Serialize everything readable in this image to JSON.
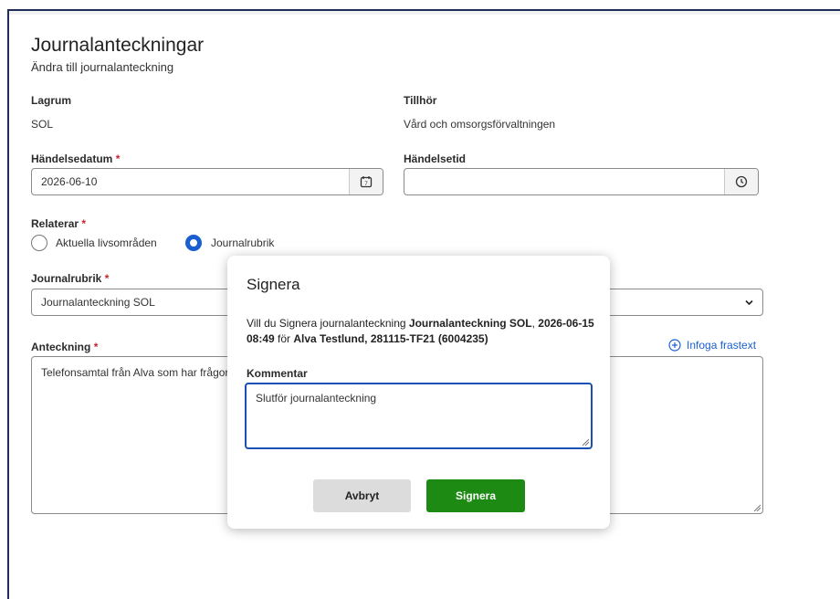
{
  "page": {
    "title": "Journalanteckningar",
    "subtitle": "Ändra till journalanteckning"
  },
  "form": {
    "lagrum": {
      "label": "Lagrum",
      "value": "SOL"
    },
    "tillhor": {
      "label": "Tillhör",
      "value": "Vård och omsorgsförvaltningen"
    },
    "handelsedatum": {
      "label": "Händelsedatum",
      "required_mark": "*",
      "value": "2026-06-10",
      "icon": "calendar-icon"
    },
    "handelsetid": {
      "label": "Händelsetid",
      "value": "",
      "icon": "clock-icon"
    },
    "relaterar": {
      "label": "Relaterar",
      "required_mark": "*",
      "options": [
        {
          "label": "Aktuella livsområden",
          "selected": false
        },
        {
          "label": "Journalrubrik",
          "selected": true
        }
      ]
    },
    "journalrubrik": {
      "label": "Journalrubrik",
      "required_mark": "*",
      "value": "Journalanteckning SOL",
      "icon": "chevron-down-icon"
    },
    "anteckning": {
      "label": "Anteckning",
      "required_mark": "*",
      "value": "Telefonsamtal från Alva som har frågor"
    },
    "infoga_frastext": {
      "label": "Infoga frastext",
      "icon": "plus-circle-icon"
    }
  },
  "dialog": {
    "title": "Signera",
    "message_prefix": "Vill du Signera journalanteckning ",
    "message_bold1": "Journalanteckning SOL",
    "message_sep1": ", ",
    "message_bold2": "2026-06-15 08:49",
    "message_mid": " för ",
    "message_bold3": "Alva Testlund, 281115-TF21 (6004235)",
    "comment_label": "Kommentar",
    "comment_value": "Slutför journalanteckning",
    "cancel_label": "Avbryt",
    "confirm_label": "Signera"
  },
  "colors": {
    "accent_blue": "#1a5fcf",
    "confirm_green": "#1d8a14",
    "cancel_gray": "#dcdcdc",
    "required_red": "#c0262d",
    "frame_navy": "#1f2d5a"
  }
}
